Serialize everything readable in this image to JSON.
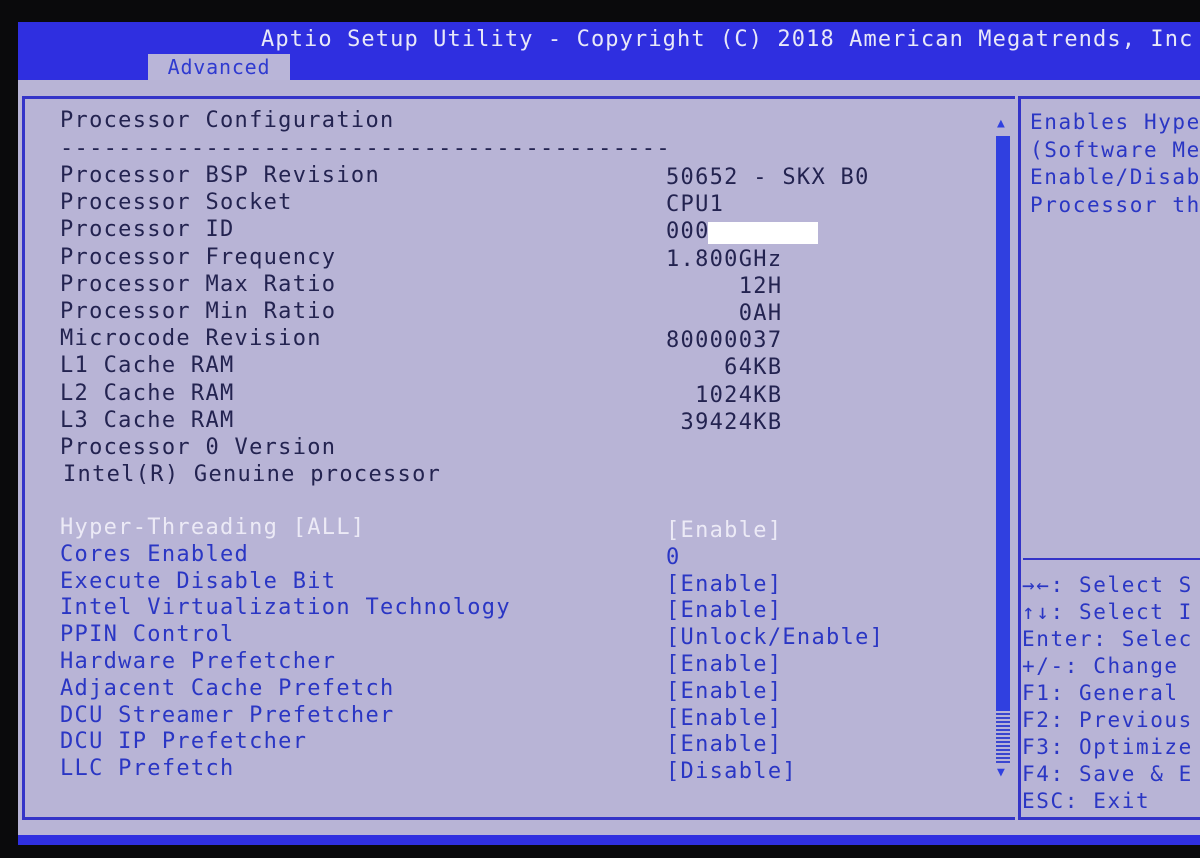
{
  "header": {
    "title": "Aptio Setup Utility - Copyright (C) 2018 American Megatrends, Inc",
    "active_tab": "Advanced"
  },
  "main": {
    "section_title": "Processor Configuration",
    "separator": "------------------------------------------",
    "info": [
      {
        "label": "Processor BSP Revision",
        "value": "50652 - SKX B0"
      },
      {
        "label": "Processor Socket",
        "value": "CPU1"
      },
      {
        "label": "Processor ID",
        "value": "000"
      },
      {
        "label": "Processor Frequency",
        "value": "1.800GHz"
      },
      {
        "label": "Processor Max Ratio",
        "value": "     12H"
      },
      {
        "label": "Processor Min Ratio",
        "value": "     0AH"
      },
      {
        "label": "Microcode Revision",
        "value": "80000037"
      },
      {
        "label": "L1 Cache RAM",
        "value": "    64KB"
      },
      {
        "label": "L2 Cache RAM",
        "value": "  1024KB"
      },
      {
        "label": "L3 Cache RAM",
        "value": " 39424KB"
      },
      {
        "label": "Processor 0 Version",
        "value": ""
      },
      {
        "label": "Intel(R) Genuine processor",
        "value": ""
      }
    ],
    "settings": [
      {
        "label": "Hyper-Threading [ALL]",
        "value": "[Enable]",
        "selected": true
      },
      {
        "label": "Cores Enabled",
        "value": "0"
      },
      {
        "label": "Execute Disable Bit",
        "value": "[Enable]"
      },
      {
        "label": "Intel Virtualization Technology",
        "value": "[Enable]"
      },
      {
        "label": "PPIN Control",
        "value": "[Unlock/Enable]"
      },
      {
        "label": "Hardware Prefetcher",
        "value": "[Enable]"
      },
      {
        "label": "Adjacent Cache Prefetch",
        "value": "[Enable]"
      },
      {
        "label": "DCU Streamer Prefetcher",
        "value": "[Enable]"
      },
      {
        "label": "DCU IP Prefetcher",
        "value": "[Enable]"
      },
      {
        "label": "LLC Prefetch",
        "value": "[Disable]"
      }
    ]
  },
  "help": {
    "lines": [
      "Enables Hype",
      "(Software Me",
      "Enable/Disab",
      "Processor th"
    ],
    "keys": [
      "→←: Select S",
      "↑↓: Select I",
      "Enter: Selec",
      "+/-: Change ",
      "F1: General ",
      "F2: Previous",
      "F3: Optimize",
      "F4: Save & E",
      "ESC: Exit"
    ]
  },
  "colors": {
    "header": "#2f2fe0",
    "background": "#b8b4d6",
    "setting_text": "#2a36c4",
    "info_text": "#232350",
    "selected_text": "#eceaf6"
  }
}
